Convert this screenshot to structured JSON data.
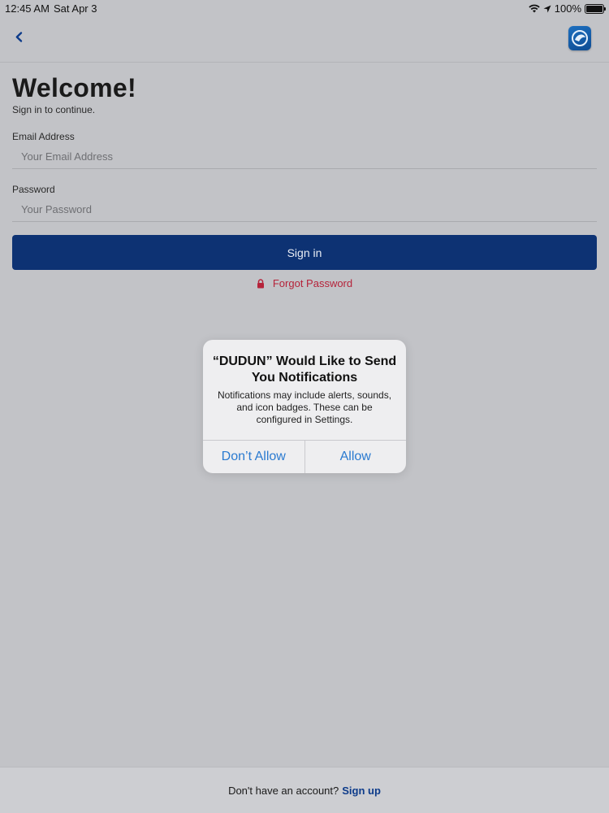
{
  "status_bar": {
    "time": "12:45 AM",
    "date": "Sat Apr 3",
    "battery": "100%",
    "icons": [
      "wifi-icon",
      "location-arrow-icon",
      "battery-icon"
    ]
  },
  "nav": {
    "back_icon": "chevron-left-icon",
    "logo_icon": "app-logo-icon"
  },
  "login": {
    "title": "Welcome!",
    "subtitle": "Sign in to continue.",
    "email_label": "Email Address",
    "email_placeholder": "Your Email Address",
    "email_value": "",
    "password_label": "Password",
    "password_placeholder": "Your Password",
    "password_value": "",
    "signin_label": "Sign in",
    "forgot_label": "Forgot Password",
    "forgot_icon": "lock-icon"
  },
  "alert": {
    "title": "“DUDUN” Would Like to Send You Notifications",
    "message": "Notifications may include alerts, sounds, and icon badges. These can be configured in Settings.",
    "dont_allow_label": "Don’t Allow",
    "allow_label": "Allow"
  },
  "footer": {
    "prompt": "Don't have an account?",
    "link": "Sign up"
  },
  "colors": {
    "primary": "#0d3273",
    "danger": "#b5233a",
    "alert_action": "#2a7ad0",
    "dimmed_background": "#c2c3c7"
  }
}
